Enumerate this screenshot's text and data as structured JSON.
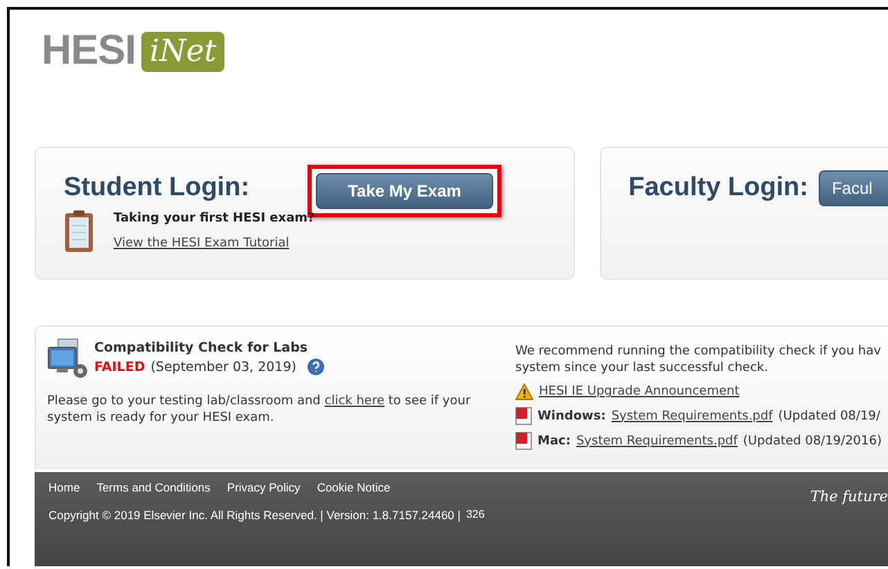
{
  "logo": {
    "brand": "HESI",
    "product": "iNet"
  },
  "student_login": {
    "title": "Student Login:",
    "button": {
      "label": "Take My Exam",
      "highlighted": true
    },
    "tutorial_prompt": "Taking your first HESI exam?",
    "tutorial_link": "View the HESI Exam Tutorial"
  },
  "faculty_login": {
    "title": "Faculty Login:",
    "button": {
      "label": "Facul"
    }
  },
  "compatibility": {
    "title": "Compatibility Check for Labs",
    "status": "FAILED",
    "date": "(September 03, 2019)",
    "instructions": "Please go to your testing lab/classroom and",
    "instructions_link": "click here",
    "instructions_end": "to see if your system is ready for your HESI exam.",
    "recommendation": "We recommend running the compatibility check if you hav",
    "recommendation_line2": "system since your last successful check.",
    "links": [
      {
        "kind": "warning",
        "link": "HESI IE Upgrade Announcement"
      },
      {
        "kind": "pdf",
        "label": "Windows:",
        "link": "System Requirements.pdf",
        "note": "(Updated 08/19/"
      },
      {
        "kind": "pdf",
        "label": "Mac:",
        "link": "System Requirements.pdf",
        "note": "(Updated 08/19/2016)"
      }
    ]
  },
  "footer": {
    "links": [
      "Home",
      "Terms and Conditions",
      "Privacy Policy",
      "Cookie Notice"
    ],
    "copyright": "Copyright © 2019 Elsevier Inc. All Rights Reserved. | Version: 1.8.7157.24460 |",
    "build": "326",
    "tagline": "The future"
  }
}
